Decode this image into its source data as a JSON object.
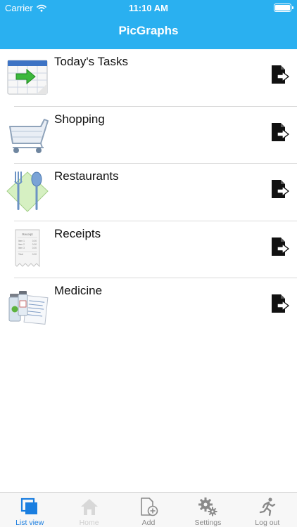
{
  "status_bar": {
    "carrier": "Carrier",
    "time": "11:10 AM"
  },
  "app": {
    "title": "PicGraphs"
  },
  "list": [
    {
      "title": "Today's Tasks",
      "icon": "calendar-icon"
    },
    {
      "title": "Shopping",
      "icon": "shopping-cart-icon"
    },
    {
      "title": "Restaurants",
      "icon": "fork-spoon-icon"
    },
    {
      "title": "Receipts",
      "icon": "receipt-icon"
    },
    {
      "title": "Medicine",
      "icon": "medicine-icon"
    }
  ],
  "receipt_thumb": {
    "heading": "Receipt",
    "lines": [
      {
        "label": "Item 1",
        "amount": "0.00"
      },
      {
        "label": "Item 2",
        "amount": "0.00"
      },
      {
        "label": "Item 3",
        "amount": "0.00"
      },
      {
        "label": "Total",
        "amount": "0.00"
      }
    ]
  },
  "tabs": [
    {
      "label": "List view",
      "icon": "list-view-icon",
      "state": "active"
    },
    {
      "label": "Home",
      "icon": "home-icon",
      "state": "disabled"
    },
    {
      "label": "Add",
      "icon": "add-document-icon",
      "state": "normal"
    },
    {
      "label": "Settings",
      "icon": "gears-icon",
      "state": "normal"
    },
    {
      "label": "Log out",
      "icon": "running-person-icon",
      "state": "normal"
    }
  ],
  "colors": {
    "header": "#2ab0f0",
    "active_tab": "#1a7ee0",
    "inactive_tab": "#8a8a8a",
    "disabled_tab": "#cfcfcf"
  }
}
